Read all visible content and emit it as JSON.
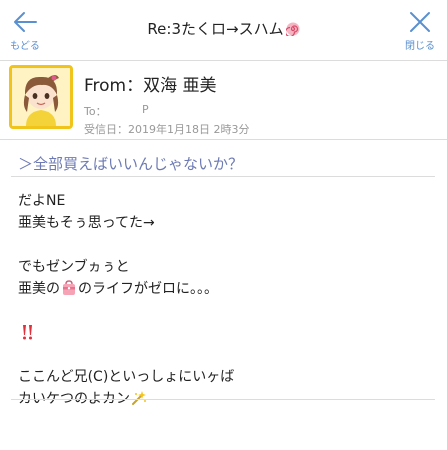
{
  "header": {
    "back_label": "もどる",
    "title": "Re:3たくロ→スハム",
    "close_label": "閉じる"
  },
  "sender": {
    "from": "From：双海 亜美",
    "to_label": "To：",
    "to_value": "P",
    "date": "受信日：2019年1月18日 2時3分"
  },
  "subject": "＞全部買えばいいんじゃないか？",
  "body": {
    "line1": "だよNE",
    "line2": "亜美もそぅ思ってた→",
    "line3": "でもゼンブヵぅと",
    "line4_a": "亜美の",
    "line4_b": "のライフがゼロに。。。",
    "line5": "ここんど兄(C)といっしょにいヶば",
    "line6": "カいケつのよカン"
  },
  "icons": {
    "back": "arrow-left-icon",
    "close": "close-x-icon",
    "spiral": "spiral-emoji-icon",
    "wallet": "purse-emoji-icon",
    "exclaim": "double-exclamation-icon",
    "sparkle": "sparkle-emoji-icon"
  },
  "colors": {
    "accent": "#5a8fd0",
    "subject": "#6d7ab3",
    "avatar_frame": "#f1c41c"
  }
}
